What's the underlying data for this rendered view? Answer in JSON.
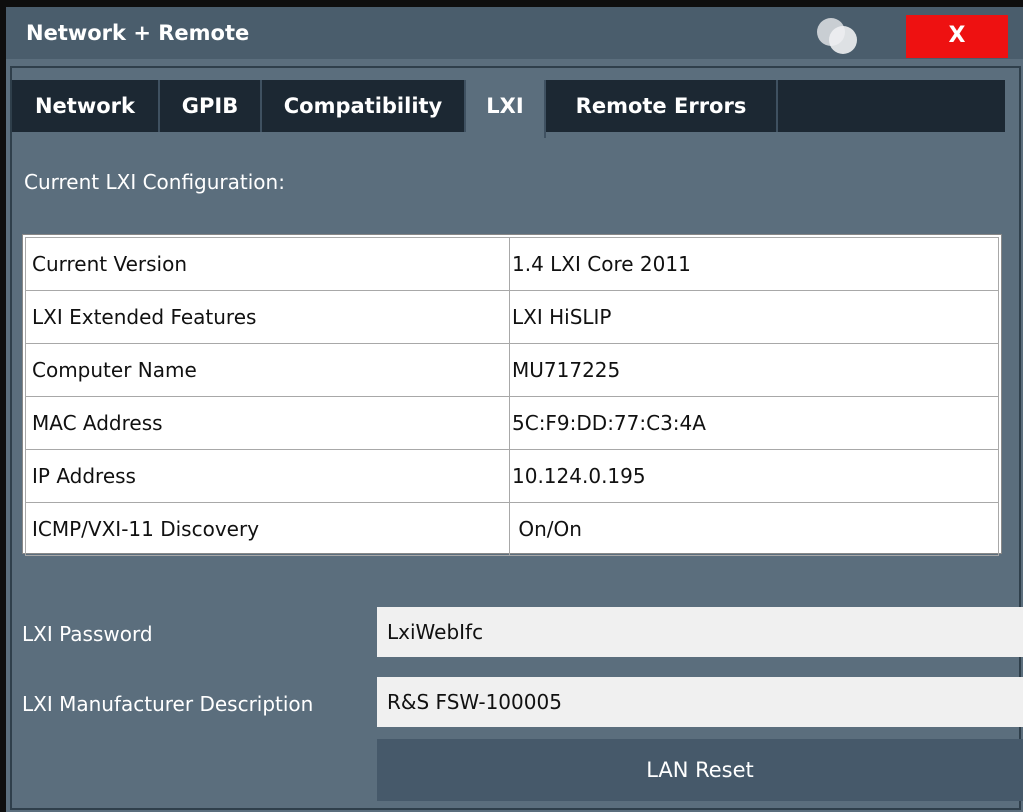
{
  "window": {
    "title": "Network + Remote",
    "close_label": "X"
  },
  "tabs": [
    {
      "label": "Network"
    },
    {
      "label": "GPIB"
    },
    {
      "label": "Compatibility"
    },
    {
      "label": "LXI",
      "active": true
    },
    {
      "label": "Remote Errors"
    }
  ],
  "section_title": "Current LXI Configuration:",
  "config_table": [
    {
      "name": "Current Version",
      "value": "1.4 LXI Core 2011"
    },
    {
      "name": "LXI Extended Features",
      "value": "LXI HiSLIP"
    },
    {
      "name": "Computer Name",
      "value": "MU717225"
    },
    {
      "name": "MAC Address",
      "value": "5C:F9:DD:77:C3:4A"
    },
    {
      "name": "IP Address",
      "value": "10.124.0.195"
    },
    {
      "name": "ICMP/VXI-11 Discovery",
      "value": " On/On"
    }
  ],
  "password": {
    "label": "LXI Password",
    "value": "LxiWebIfc"
  },
  "manufacturer": {
    "label": "LXI Manufacturer Description",
    "value": "R&S FSW-100005"
  },
  "lan_reset_label": "LAN Reset",
  "colors": {
    "titlebar": "#4a5d6c",
    "panel": "#5b6e7d",
    "tab_inactive": "#1c2833",
    "close": "#ee1111"
  },
  "icons": {
    "window": "overlapping-circles-icon"
  }
}
